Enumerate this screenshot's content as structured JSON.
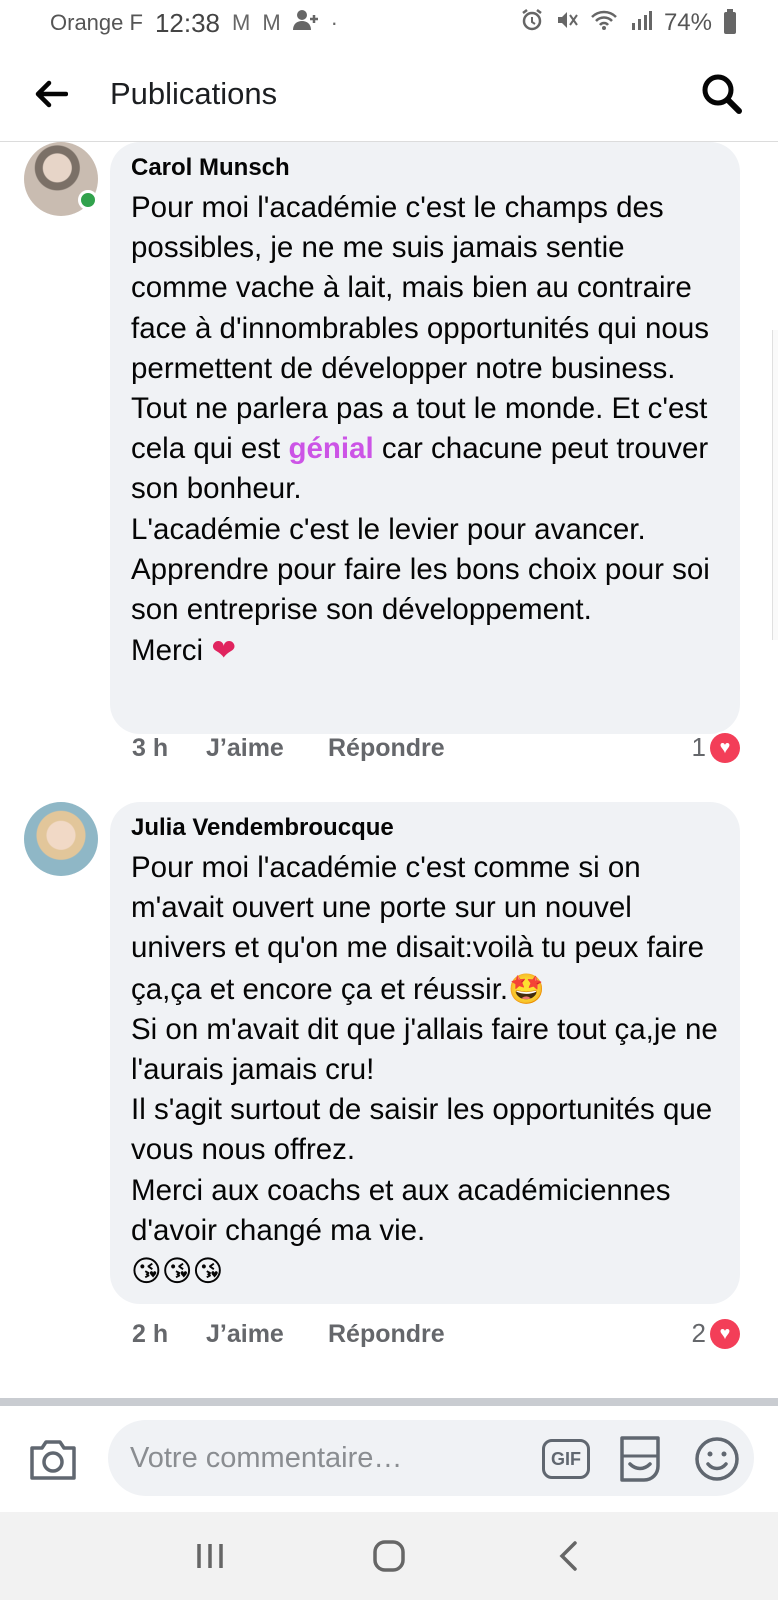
{
  "status_bar": {
    "carrier": "Orange F",
    "time": "12:38",
    "battery": "74%"
  },
  "header": {
    "title": "Publications"
  },
  "comments": [
    {
      "author": "Carol Munsch",
      "text_before": "Pour moi l'académie c'est le champs des possibles, je ne me suis jamais sentie comme vache à lait, mais bien au contraire face à d'innombrables opportunités qui nous permettent de développer notre business. Tout ne parlera pas a tout le monde. Et c'est cela qui est ",
      "highlight": "génial",
      "text_after": " car chacune peut trouver son bonheur.\nL'académie c'est le levier pour avancer.\nApprendre pour faire les bons choix pour soi son entreprise son développement.\nMerci ",
      "emoji": "❤",
      "time": "3 h",
      "like_label": "J’aime",
      "reply_label": "Répondre",
      "reaction_count": "1",
      "online": true
    },
    {
      "author": "Julia Vendembroucque",
      "text": "Pour moi l'académie c'est comme si on m'avait ouvert une porte sur un nouvel univers et qu'on me disait:voilà tu peux faire ça,ça et encore ça et réussir.",
      "emoji_inline": "🤩",
      "text2": "\nSi on m'avait dit que j'allais faire tout ça,je ne l'aurais jamais cru!\nIl s'agit surtout de saisir les opportunités que vous nous  offrez.\nMerci aux coachs et aux académiciennes d'avoir changé ma vie.\n",
      "emoji_end": "😘😘😘",
      "time": "2 h",
      "like_label": "J’aime",
      "reply_label": "Répondre",
      "reaction_count": "2"
    }
  ],
  "composer": {
    "placeholder": "Votre commentaire…",
    "gif_label": "GIF"
  },
  "icons": {
    "back": "arrow-left",
    "search": "magnifier",
    "camera": "camera",
    "sticker": "sticker",
    "emoji": "smiley",
    "nav": [
      "recent-apps",
      "home",
      "back"
    ]
  },
  "colors": {
    "bubble": "#f0f2f5",
    "highlight": "#cc54e6",
    "heart": "#f33e58",
    "online": "#31a24c"
  }
}
